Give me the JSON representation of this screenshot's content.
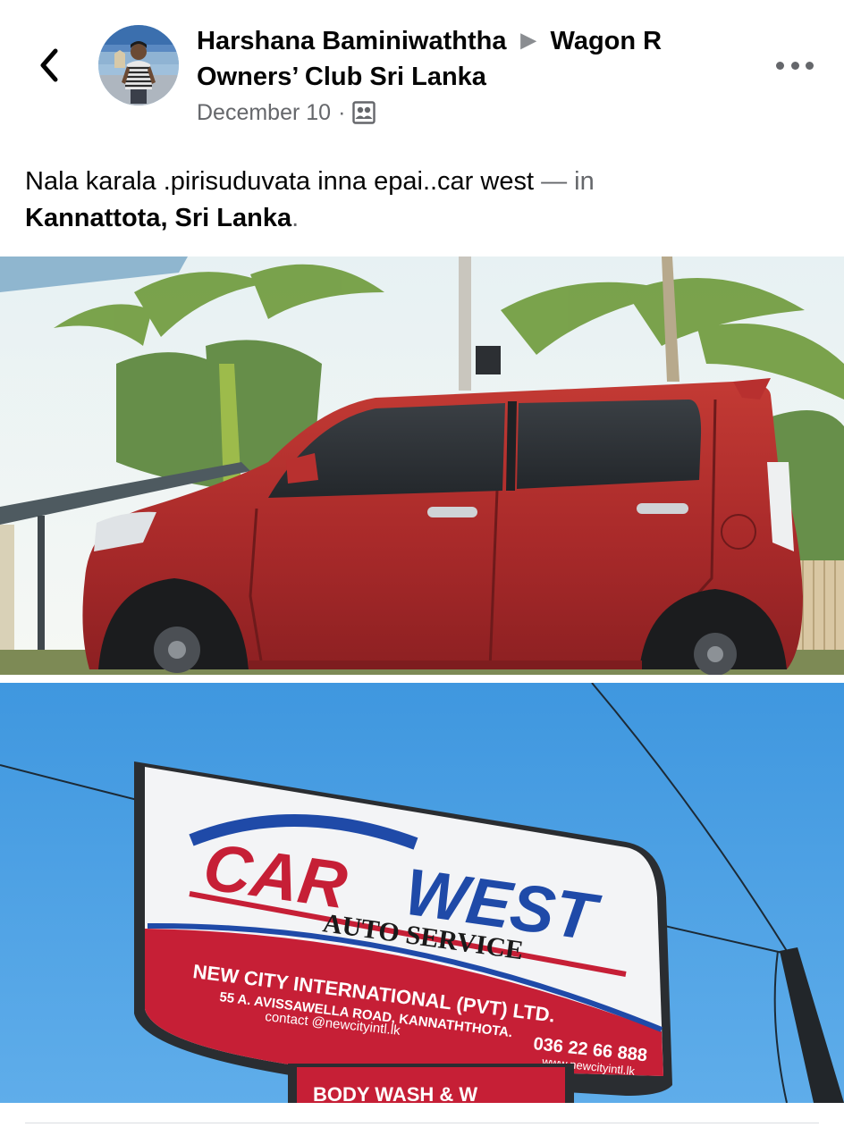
{
  "header": {
    "author": "Harshana Baminiwaththa",
    "group": "Wagon R Owners’ Club Sri Lanka",
    "date": "December 10",
    "separator": "·",
    "icons": {
      "back": "chevron-left-icon",
      "audience": "group-audience-icon",
      "more": "more-dots-icon",
      "group_arrow": "triangle-right-icon"
    }
  },
  "post": {
    "text": "Nala karala .pirisuduvata inna epai..car west",
    "dash_in": " — in",
    "location": "Kannattota, Sri Lanka",
    "period": "."
  },
  "sign": {
    "brand_left": "CAR",
    "brand_right": "WEST",
    "tagline": "AUTO SERVICE",
    "company": "NEW CITY INTERNATIONAL (PVT) LTD.",
    "address": "55 A. AVISSAWELLA ROAD, KANNATHTHOTA.",
    "contact": "contact @newcityintl.lk",
    "phone": "036 22 66 888",
    "website": "www.newcityintl.lk",
    "lower_sign": "BODY WASH & W"
  },
  "colors": {
    "text_primary": "#050505",
    "text_secondary": "#65676b",
    "car_red": "#b8302f",
    "sky_blue": "#3f97df",
    "sign_red": "#c61f36",
    "sign_blue": "#1f4aa8"
  }
}
